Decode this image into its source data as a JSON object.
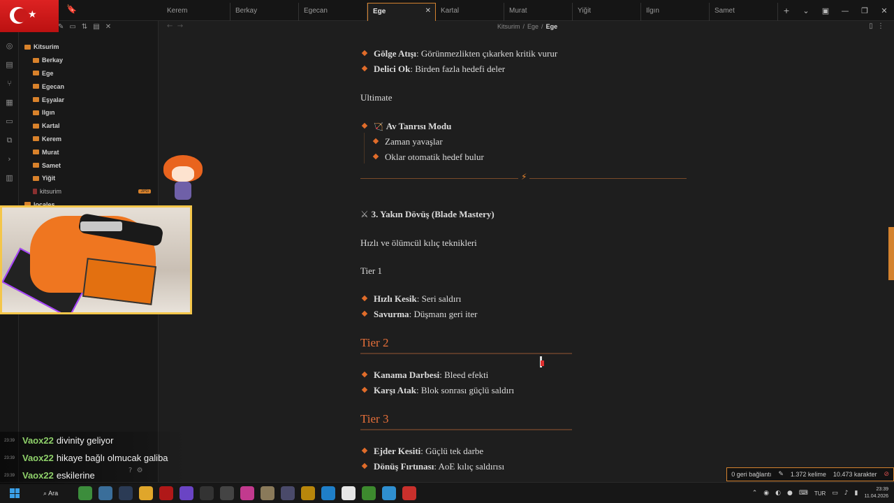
{
  "tabs": [
    {
      "label": "Kerem"
    },
    {
      "label": "Berkay"
    },
    {
      "label": "Egecan"
    },
    {
      "label": "Ege",
      "active": true
    },
    {
      "label": "Kartal"
    },
    {
      "label": "Murat"
    },
    {
      "label": "Yiğit"
    },
    {
      "label": "Ilgın"
    },
    {
      "label": "Samet"
    }
  ],
  "breadcrumb": {
    "root": "Kitsurim",
    "parent": "Ege",
    "current": "Ege"
  },
  "sidebar": {
    "root": "Kitsurim",
    "folders": [
      "Berkay",
      "Ege",
      "Egecan",
      "Eşyalar",
      "Ilgın",
      "Kartal",
      "Kerem",
      "Murat",
      "Samet",
      "Yiğit"
    ],
    "file": {
      "name": "kitsurim",
      "badge": "JPG"
    },
    "partial": "locales"
  },
  "doc": {
    "skills_top": [
      {
        "name": "Gölge Atışı",
        "desc": "Görünmezlikten çıkarken kritik vurur"
      },
      {
        "name": "Delici Ok",
        "desc": "Birden fazla hedefi deler"
      }
    ],
    "ultimate_label": "Ultimate",
    "ultimate": {
      "name": "Av Tanrısı Modu",
      "effects": [
        "Zaman yavaşlar",
        "Oklar otomatik hedef bulur"
      ]
    },
    "section_heading": "3. Yakın Dövüş (Blade Mastery)",
    "section_desc": "Hızlı ve ölümcül kılıç teknikleri",
    "tier1_label": "Tier 1",
    "tier1": [
      {
        "name": "Hızlı Kesik",
        "desc": "Seri saldırı"
      },
      {
        "name": "Savurma",
        "desc": "Düşmanı geri iter"
      }
    ],
    "tier2_heading": "Tier 2",
    "tier2": [
      {
        "name": "Kanama Darbesi",
        "desc": "Bleed efekti"
      },
      {
        "name": "Karşı Atak",
        "desc": "Blok sonrası güçlü saldırı"
      }
    ],
    "tier3_heading": "Tier 3",
    "tier3": [
      {
        "name": "Ejder Kesiti",
        "desc": "Güçlü tek darbe"
      },
      {
        "name": "Dönüş Fırtınası",
        "desc": "AoE kılıç saldırısı"
      }
    ]
  },
  "status": {
    "backlinks": "0 geri bağlantı",
    "words": "1.372 kelime",
    "chars": "10.473 karakter"
  },
  "chat": [
    {
      "time": "23:39",
      "user": "Vaox22",
      "message": "divinity geliyor"
    },
    {
      "time": "23:39",
      "user": "Vaox22",
      "message": "hikaye bağlı olmucak galiba"
    },
    {
      "time": "23:39",
      "user": "Vaox22",
      "message": "eskilerine"
    }
  ],
  "taskbar": {
    "search": "Ara",
    "lang": "TUR",
    "time": "23:39",
    "date": "11.04.2026"
  },
  "colors": {
    "accent": "#d4822e",
    "heading": "#e8703a",
    "bullet": "#e06c2a",
    "chat_user": "#8fd16a"
  }
}
